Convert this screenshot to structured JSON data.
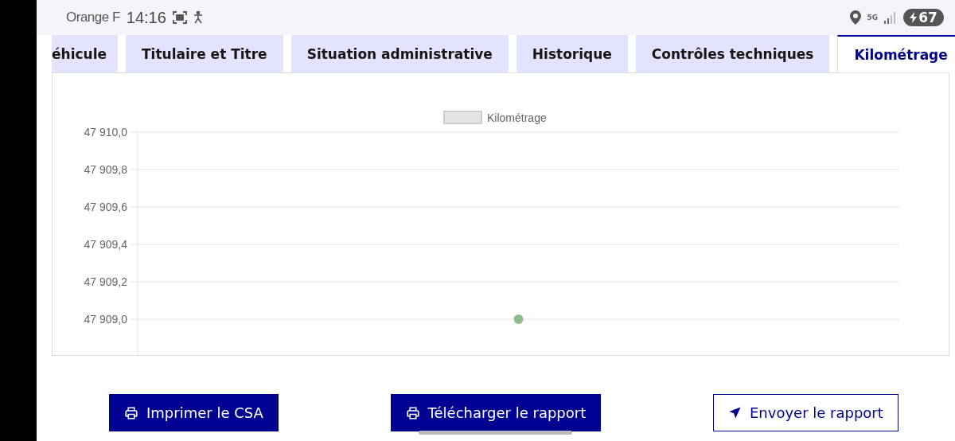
{
  "status_bar": {
    "carrier": "Orange F",
    "time": "14:16",
    "network": "5G",
    "battery": "67"
  },
  "tabs": [
    {
      "label": "éhicule",
      "selected": false
    },
    {
      "label": "Titulaire et Titre",
      "selected": false
    },
    {
      "label": "Situation administrative",
      "selected": false
    },
    {
      "label": "Historique",
      "selected": false
    },
    {
      "label": "Contrôles techniques",
      "selected": false
    },
    {
      "label": "Kilométrage",
      "selected": true
    }
  ],
  "chart": {
    "chart_data": {
      "type": "scatter",
      "ylim": [
        47908.8,
        47910.0
      ],
      "yticks": [
        {
          "value": 47910.0,
          "label": "47 910,0"
        },
        {
          "value": 47909.8,
          "label": "47 909,8"
        },
        {
          "value": 47909.6,
          "label": "47 909,6"
        },
        {
          "value": 47909.4,
          "label": "47 909,4"
        },
        {
          "value": 47909.2,
          "label": "47 909,2"
        },
        {
          "value": 47909.0,
          "label": "47 909,0"
        }
      ],
      "categories": [
        null
      ],
      "grid": true,
      "series": [
        {
          "name": "Kilométrage",
          "color": "#8fbc8f",
          "values": [
            47909.0
          ]
        }
      ]
    }
  },
  "buttons": [
    {
      "label": "Imprimer le CSA",
      "kind": "print",
      "primary": true
    },
    {
      "label": "Télécharger le rapport",
      "kind": "print",
      "primary": true
    },
    {
      "label": "Envoyer le rapport",
      "kind": "send",
      "primary": false
    }
  ]
}
